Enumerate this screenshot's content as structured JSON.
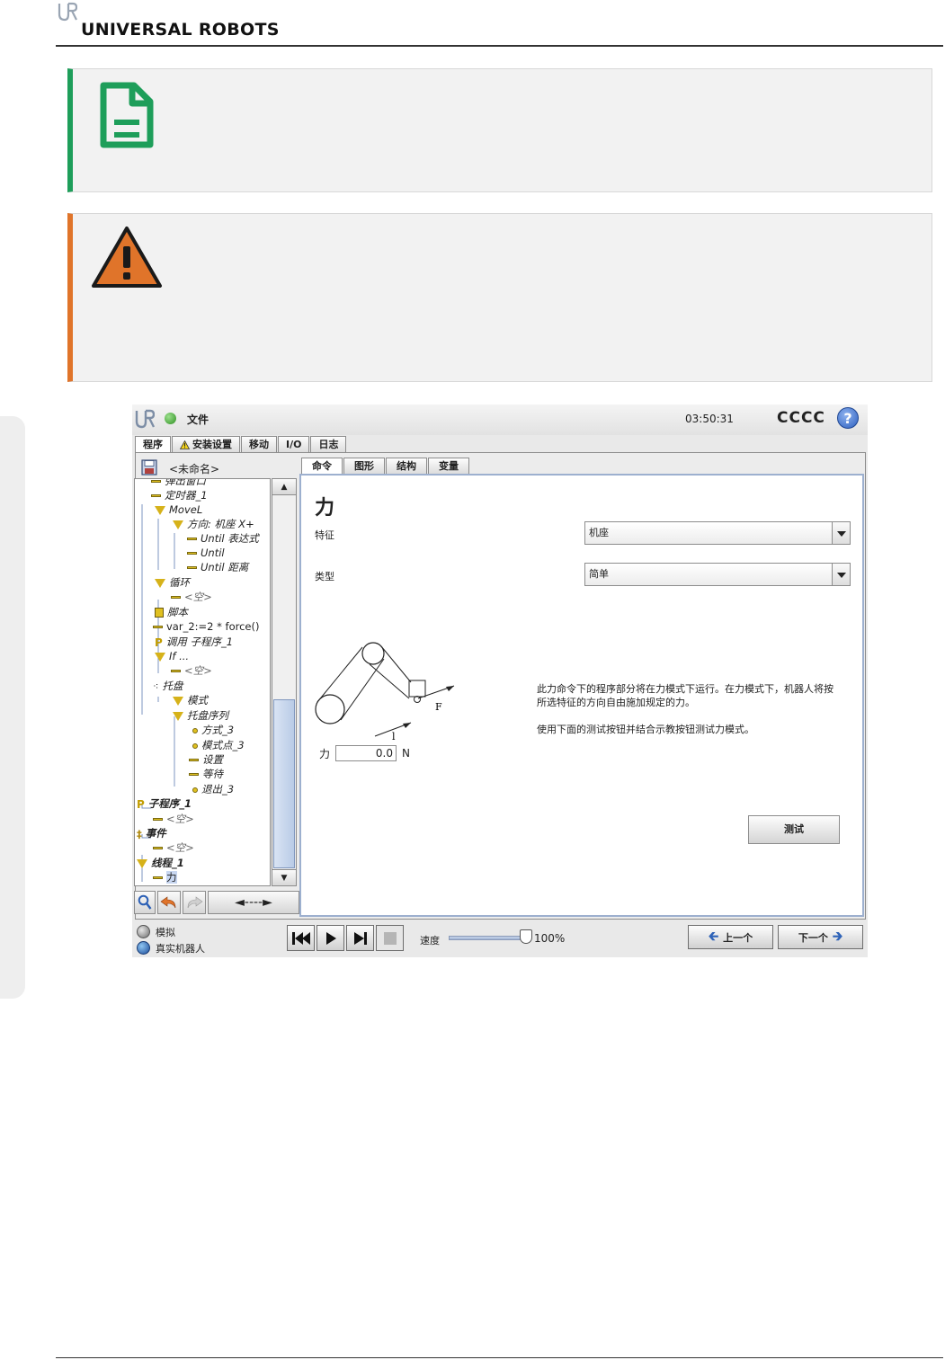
{
  "brand": {
    "name": "UNIVERSAL ROBOTS"
  },
  "notices": {
    "note_icon": "document-note-icon",
    "warning_icon": "warning-triangle-icon",
    "colors": {
      "note": "#1e9e5a",
      "warning": "#e0742a"
    }
  },
  "ui": {
    "file_menu": "文件",
    "time": "03:50:31",
    "robot_name": "CCCC",
    "help": "?",
    "tabs": [
      {
        "label": "程序"
      },
      {
        "label": "安装设置"
      },
      {
        "label": "移动"
      },
      {
        "label": "I/O"
      },
      {
        "label": "日志"
      }
    ],
    "program_name": "<未命名>",
    "tree": {
      "items": [
        "弹出窗口",
        "定时器_1",
        "MoveL",
        "方向: 机座 X+",
        "Until 表达式",
        "Until",
        "Until 距离",
        "循环",
        "<空>",
        "脚本",
        "var_2:=2 * force()",
        "调用 子程序_1",
        "If ...",
        "<空>",
        "托盘",
        "模式",
        "托盘序列",
        "方式_3",
        "模式点_3",
        "设置",
        "等待",
        "退出_3",
        "子程序_1",
        "<空>",
        "事件",
        "<空>",
        "线程_1",
        "力"
      ]
    },
    "tree_tools": {
      "search_icon": "magnifier-icon",
      "undo_icon": "undo-arrow-icon",
      "redo_icon": "redo-arrow-icon",
      "move": "◄----►"
    },
    "sub_tabs": [
      {
        "label": "命令"
      },
      {
        "label": "图形"
      },
      {
        "label": "结构"
      },
      {
        "label": "变量"
      }
    ],
    "panel": {
      "title": "力",
      "feature_label": "特征",
      "feature_value": "机座",
      "type_label": "类型",
      "type_value": "简单",
      "diagram_labels": {
        "force": "F",
        "direction": "l"
      },
      "force_label": "力",
      "force_value": "0.0",
      "force_unit": "N",
      "description": [
        "此力命令下的程序部分将在力模式下运行。在力模式下，机器人将按所选特征的方向自由施加规定的力。",
        "使用下面的测试按钮并结合示教按钮测试力模式。"
      ],
      "test_button": "测试"
    },
    "footer": {
      "mode_sim": "模拟",
      "mode_real": "真实机器人",
      "speed_label": "速度",
      "speed_value": "100%",
      "speed_fraction": 1.0,
      "prev": "上一个",
      "next": "下一个"
    }
  }
}
